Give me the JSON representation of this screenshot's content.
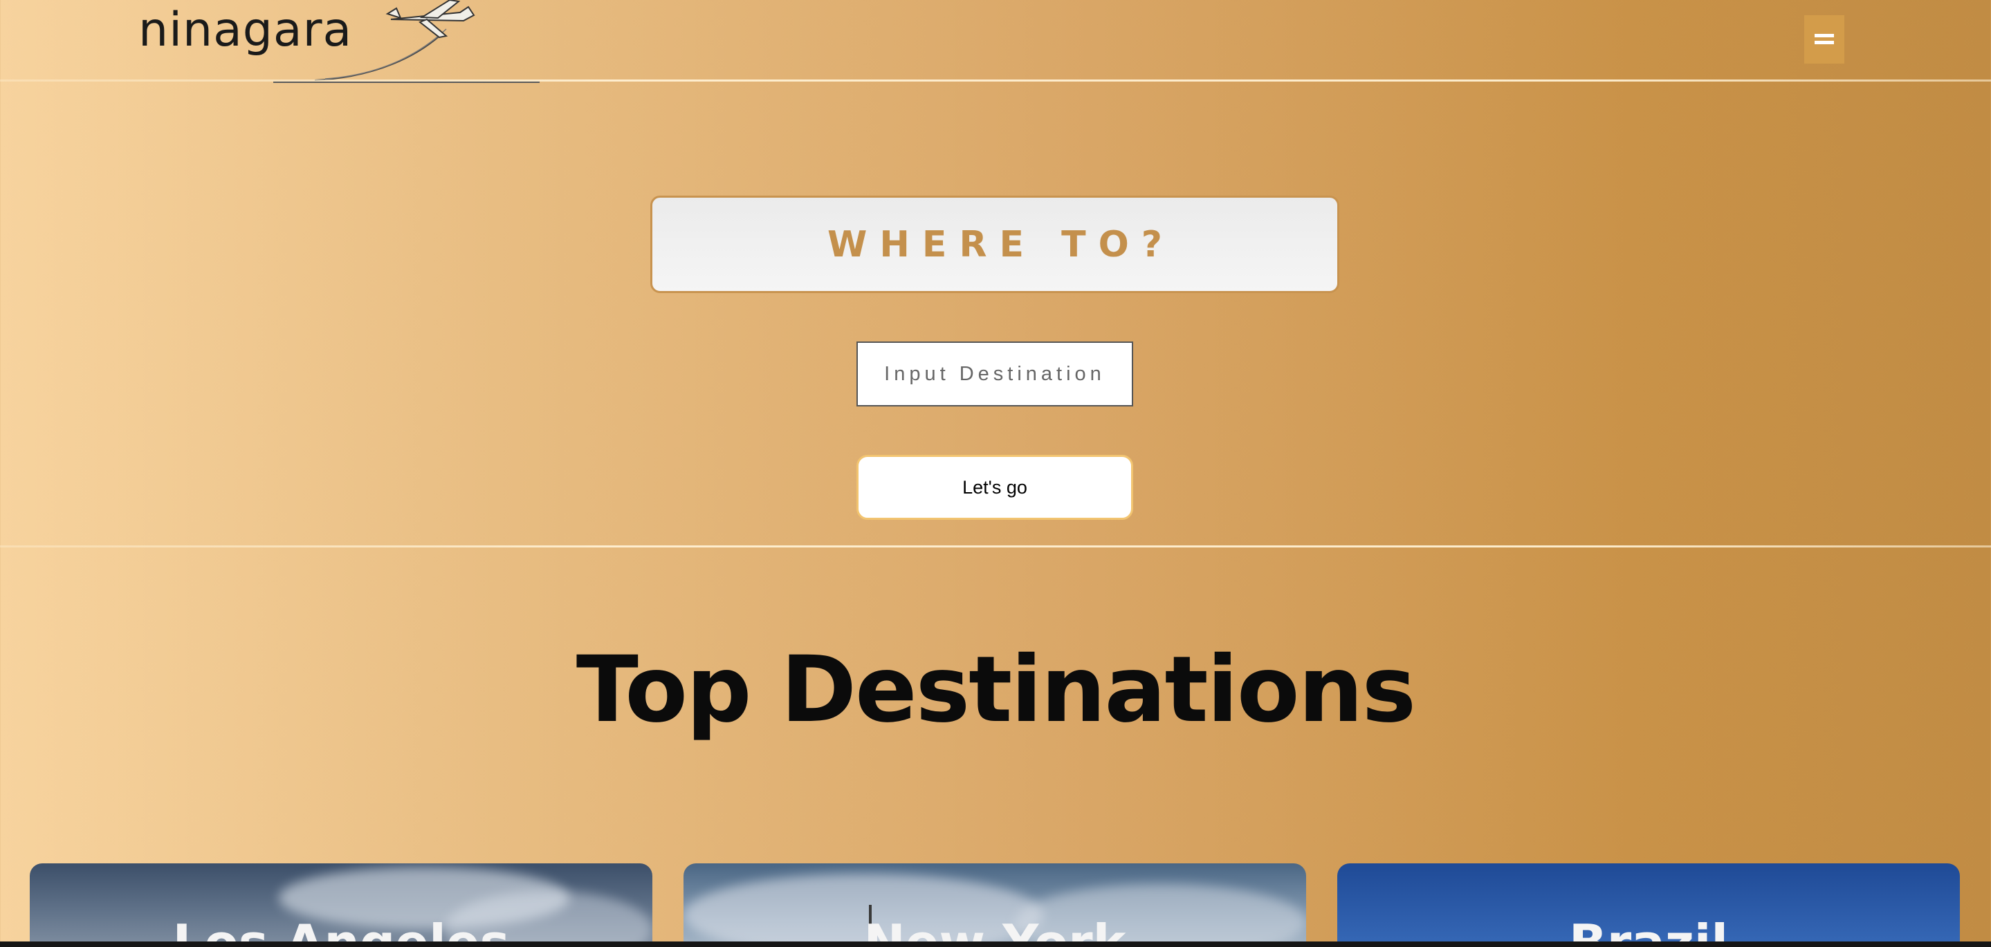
{
  "header": {
    "logo_text": "ninagara",
    "logo_icon": "airplane-icon",
    "menu_icon": "hamburger-menu-icon"
  },
  "search": {
    "heading": "WHERE TO?",
    "input_placeholder": "Input Destination",
    "input_value": "",
    "submit_label": "Let's go"
  },
  "destinations": {
    "title": "Top Destinations",
    "cards": [
      {
        "name": "Los Angeles"
      },
      {
        "name": "New York"
      },
      {
        "name": "Brazil"
      }
    ]
  },
  "colors": {
    "accent": "#c4904c",
    "button_border": "#f2c470",
    "menu_bg": "#d39c4a"
  }
}
